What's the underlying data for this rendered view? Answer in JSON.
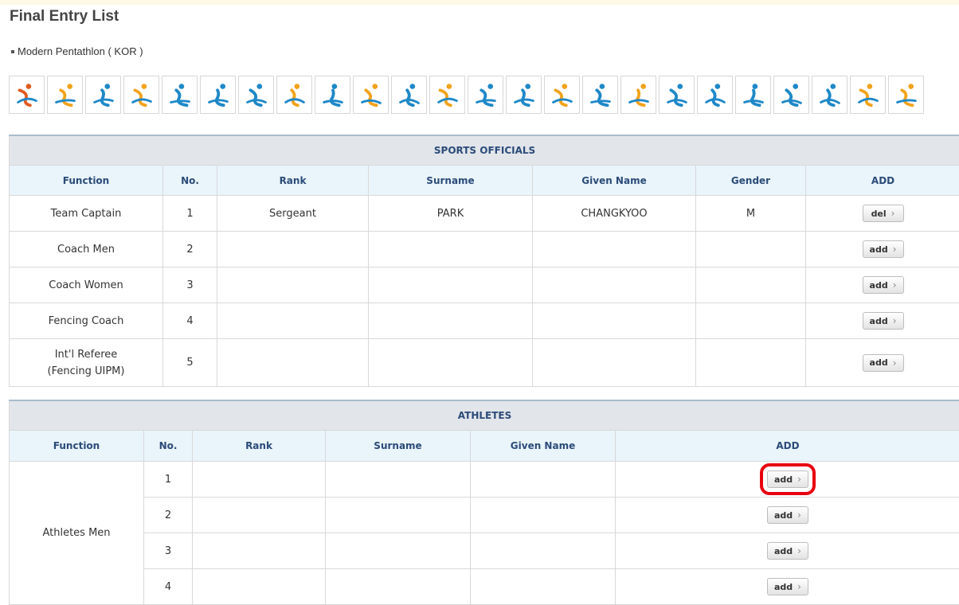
{
  "page": {
    "title": "Final Entry List",
    "subtitle": "Modern Pentathlon ( KOR )"
  },
  "sports": [
    {
      "icon": "shooting-icon",
      "color": "#e05a20"
    },
    {
      "icon": "archery-icon",
      "color": "#f2a31b"
    },
    {
      "icon": "athletics-icon",
      "color": "#1e88c8"
    },
    {
      "icon": "badminton-icon",
      "color": "#f2a31b"
    },
    {
      "icon": "cycling-icon",
      "color": "#1e88c8"
    },
    {
      "icon": "diving-icon",
      "color": "#1e88c8"
    },
    {
      "icon": "equestrian-icon",
      "color": "#1e88c8"
    },
    {
      "icon": "fencing-icon",
      "color": "#f2a31b"
    },
    {
      "icon": "gymnastics-icon",
      "color": "#1e88c8"
    },
    {
      "icon": "handball-icon",
      "color": "#f2a31b"
    },
    {
      "icon": "hockey-icon",
      "color": "#1e88c8"
    },
    {
      "icon": "judo-icon",
      "color": "#f2a31b"
    },
    {
      "icon": "karate-icon",
      "color": "#1e88c8"
    },
    {
      "icon": "kabaddi-icon",
      "color": "#1e88c8"
    },
    {
      "icon": "modern-pentathlon-icon",
      "color": "#f2a31b"
    },
    {
      "icon": "rowing-icon",
      "color": "#1e88c8"
    },
    {
      "icon": "rugby-icon",
      "color": "#f2a31b"
    },
    {
      "icon": "sailing-icon",
      "color": "#1e88c8"
    },
    {
      "icon": "canoe-icon",
      "color": "#1e88c8"
    },
    {
      "icon": "soft-tennis-icon",
      "color": "#1e88c8"
    },
    {
      "icon": "swimming-icon",
      "color": "#1e88c8"
    },
    {
      "icon": "triathlon-icon",
      "color": "#1e88c8"
    },
    {
      "icon": "taekwondo-icon",
      "color": "#f2a31b"
    },
    {
      "icon": "wushu-icon",
      "color": "#f2a31b"
    }
  ],
  "officials": {
    "section_title": "SPORTS OFFICIALS",
    "headers": {
      "function": "Function",
      "no": "No.",
      "rank": "Rank",
      "surname": "Surname",
      "given_name": "Given Name",
      "gender": "Gender",
      "add": "ADD"
    },
    "rows": [
      {
        "function_lines": [
          "Team Captain"
        ],
        "no": "1",
        "rank": "Sergeant",
        "surname": "PARK",
        "given_name": "CHANGKYOO",
        "gender": "M",
        "button": "del"
      },
      {
        "function_lines": [
          "Coach Men"
        ],
        "no": "2",
        "rank": "",
        "surname": "",
        "given_name": "",
        "gender": "",
        "button": "add"
      },
      {
        "function_lines": [
          "Coach Women"
        ],
        "no": "3",
        "rank": "",
        "surname": "",
        "given_name": "",
        "gender": "",
        "button": "add"
      },
      {
        "function_lines": [
          "Fencing Coach"
        ],
        "no": "4",
        "rank": "",
        "surname": "",
        "given_name": "",
        "gender": "",
        "button": "add"
      },
      {
        "function_lines": [
          "Int'l Referee",
          "(Fencing UIPM)"
        ],
        "no": "5",
        "rank": "",
        "surname": "",
        "given_name": "",
        "gender": "",
        "button": "add"
      }
    ]
  },
  "athletes": {
    "section_title": "ATHLETES",
    "headers": {
      "function": "Function",
      "no": "No.",
      "rank": "Rank",
      "surname": "Surname",
      "given_name": "Given Name",
      "add": "ADD"
    },
    "group_label": "Athletes Men",
    "rows": [
      {
        "no": "1",
        "button": "add",
        "highlighted": true
      },
      {
        "no": "2",
        "button": "add",
        "highlighted": false
      },
      {
        "no": "3",
        "button": "add",
        "highlighted": false
      },
      {
        "no": "4",
        "button": "add",
        "highlighted": false
      }
    ]
  },
  "colors": {
    "section_header_bg": "#e2e5ea",
    "column_header_bg": "#e9f4fb",
    "header_text": "#2b4b78",
    "highlight": "#e8000f"
  }
}
